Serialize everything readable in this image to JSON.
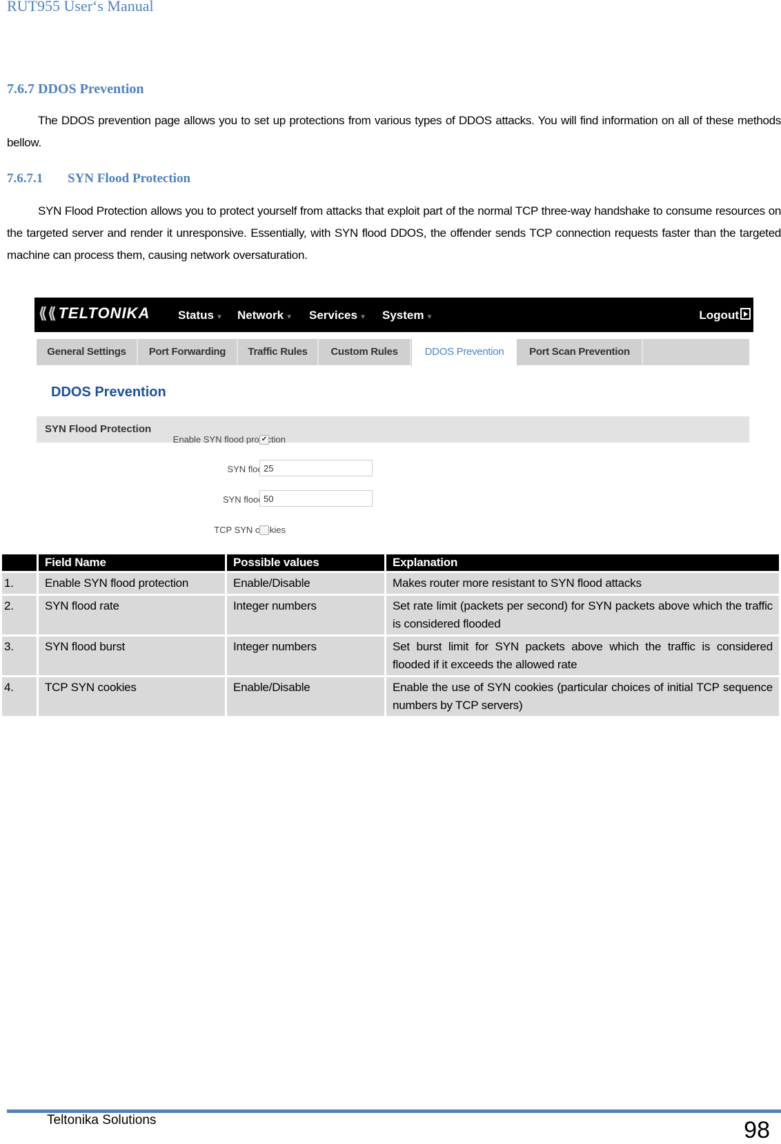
{
  "header": {
    "running_title": "RUT955 User‘s Manual"
  },
  "section": {
    "number": "7.6.7",
    "title": "DDOS Prevention",
    "intro": "The DDOS prevention page allows you to set up protections from various types of DDOS attacks. You will find information on all of these methods bellow."
  },
  "subsection": {
    "number": "7.6.7.1",
    "title": "SYN Flood Protection",
    "body": "SYN Flood Protection allows you to protect yourself from attacks that exploit part of the normal TCP three-way handshake to consume resources on the targeted server and render it unresponsive. Essentially, with SYN flood DDOS, the offender sends TCP connection requests faster than the targeted machine can process them, causing network oversaturation."
  },
  "screenshot": {
    "brand": "TELTONIKA",
    "nav": [
      "Status",
      "Network",
      "Services",
      "System"
    ],
    "logout": "Logout",
    "tabs": [
      {
        "label": "General Settings",
        "active": false
      },
      {
        "label": "Port Forwarding",
        "active": false
      },
      {
        "label": "Traffic Rules",
        "active": false
      },
      {
        "label": "Custom Rules",
        "active": false
      },
      {
        "label": "DDOS Prevention",
        "active": true
      },
      {
        "label": "Port Scan Prevention",
        "active": false
      }
    ],
    "page_title": "DDOS Prevention",
    "section_title": "SYN Flood Protection",
    "fields": {
      "enable_label": "Enable SYN flood protection",
      "enable_checked": true,
      "rate_label": "SYN flood rate",
      "rate_value": "25",
      "burst_label": "SYN flood burst",
      "burst_value": "50",
      "cookies_label": "TCP SYN cookies",
      "cookies_checked": false
    }
  },
  "table": {
    "headers": [
      "",
      "Field Name",
      "Possible values",
      "Explanation"
    ],
    "rows": [
      [
        "1.",
        "Enable SYN flood protection",
        "Enable/Disable",
        "Makes router more resistant to SYN flood attacks"
      ],
      [
        "2.",
        "SYN flood rate",
        "Integer numbers",
        "Set rate limit (packets per second) for SYN packets above which the traffic is considered flooded"
      ],
      [
        "3.",
        "SYN flood burst",
        "Integer numbers",
        "Set burst limit for SYN packets above which the traffic is considered flooded if it exceeds the allowed rate"
      ],
      [
        "4.",
        "TCP SYN cookies",
        "Enable/Disable",
        "Enable the use of SYN cookies (particular choices of initial TCP sequence numbers by TCP servers)"
      ]
    ]
  },
  "footer": {
    "company": "Teltonika Solutions",
    "page_number": "98"
  }
}
